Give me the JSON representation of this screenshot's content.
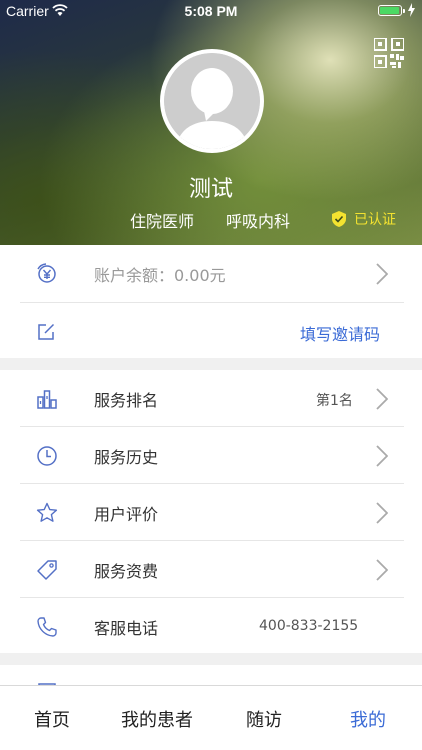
{
  "status_bar": {
    "carrier": "Carrier",
    "time": "5:08 PM"
  },
  "profile": {
    "name": "测试",
    "position": "住院医师",
    "department": "呼吸内科",
    "verified_label": "已认证",
    "verified_color": "#f3e230"
  },
  "account": {
    "balance_label": "账户余额：0.00元",
    "invite_label": "填写邀请码"
  },
  "menu": [
    {
      "label": "服务排名",
      "value": "第1名",
      "icon": "ranking-icon"
    },
    {
      "label": "服务历史",
      "value": "",
      "icon": "clock-icon"
    },
    {
      "label": "用户评价",
      "value": "",
      "icon": "star-icon"
    },
    {
      "label": "服务资费",
      "value": "",
      "icon": "tag-icon"
    },
    {
      "label": "客服电话",
      "value": "400-833-2155",
      "icon": "phone-icon"
    }
  ],
  "tabs": [
    {
      "label": "首页"
    },
    {
      "label": "我的患者"
    },
    {
      "label": "随访"
    },
    {
      "label": "我的",
      "active": true
    }
  ],
  "colors": {
    "accent": "#3b6bd6",
    "icon": "#5470c6"
  }
}
